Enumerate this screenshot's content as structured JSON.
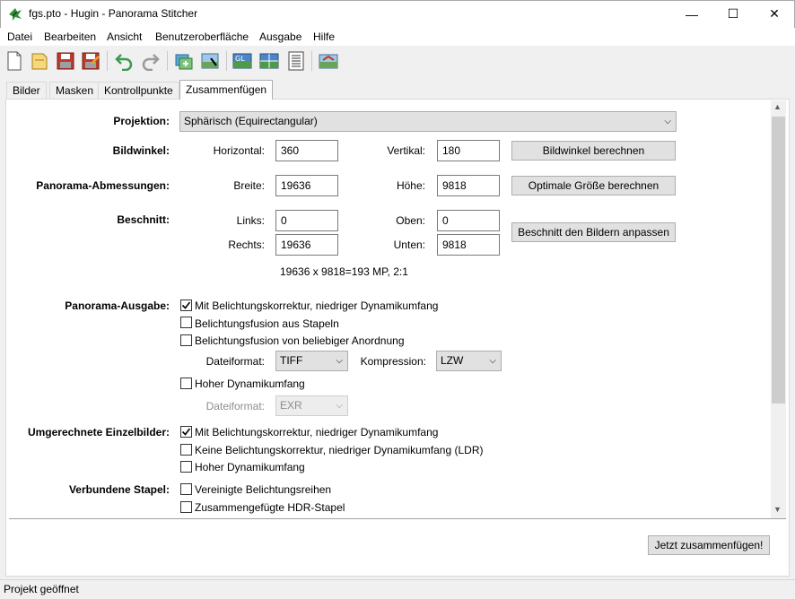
{
  "window": {
    "title": "fgs.pto - Hugin - Panorama Stitcher",
    "minimize": "—",
    "maximize": "☐",
    "close": "✕"
  },
  "menu": [
    {
      "label": "Datei"
    },
    {
      "label": "Bearbeiten"
    },
    {
      "label": "Ansicht"
    },
    {
      "label": "Benutzeroberfläche"
    },
    {
      "label": "Ausgabe"
    },
    {
      "label": "Hilfe"
    }
  ],
  "toolbar": {
    "icons": [
      "new-file-icon",
      "open-file-icon",
      "save-icon",
      "save-as-icon",
      "undo-icon",
      "redo-icon",
      "add-images-icon",
      "control-points-icon",
      "gl-preview-icon",
      "fast-preview-icon",
      "list-icon",
      "layout-preview-icon"
    ],
    "gl_label": "GL"
  },
  "tabs": [
    {
      "label": "Bilder"
    },
    {
      "label": "Masken"
    },
    {
      "label": "Kontrollpunkte"
    },
    {
      "label": "Zusammenfügen",
      "active": true
    }
  ],
  "projection": {
    "label": "Projektion:",
    "value": "Sphärisch (Equirectangular)"
  },
  "field_of_view": {
    "label": "Bildwinkel:",
    "horizontal_label": "Horizontal:",
    "horizontal_value": "360",
    "vertical_label": "Vertikal:",
    "vertical_value": "180",
    "button": "Bildwinkel berechnen"
  },
  "canvas_size": {
    "label": "Panorama-Abmessungen:",
    "width_label": "Breite:",
    "width_value": "19636",
    "height_label": "Höhe:",
    "height_value": "9818",
    "button": "Optimale Größe berechnen"
  },
  "crop": {
    "label": "Beschnitt:",
    "left_label": "Links:",
    "left_value": "0",
    "top_label": "Oben:",
    "top_value": "0",
    "right_label": "Rechts:",
    "right_value": "19636",
    "bottom_label": "Unten:",
    "bottom_value": "9818",
    "button": "Beschnitt den Bildern anpassen",
    "info": "19636 x 9818=193 MP, 2:1"
  },
  "panorama_output": {
    "label": "Panorama-Ausgabe:",
    "options": [
      {
        "label": "Mit Belichtungskorrektur, niedriger Dynamikumfang",
        "checked": true
      },
      {
        "label": "Belichtungsfusion aus Stapeln",
        "checked": false
      },
      {
        "label": "Belichtungsfusion von beliebiger Anordnung",
        "checked": false
      }
    ],
    "format_label": "Dateiformat:",
    "format_value": "TIFF",
    "compression_label": "Kompression:",
    "compression_value": "LZW",
    "hdr_option": {
      "label": "Hoher Dynamikumfang",
      "checked": false
    },
    "hdr_format_label": "Dateiformat:",
    "hdr_format_value": "EXR"
  },
  "remapped_images": {
    "label": "Umgerechnete Einzelbilder:",
    "options": [
      {
        "label": "Mit Belichtungskorrektur, niedriger Dynamikumfang",
        "checked": true
      },
      {
        "label": "Keine Belichtungskorrektur, niedriger Dynamikumfang (LDR)",
        "checked": false
      },
      {
        "label": "Hoher Dynamikumfang",
        "checked": false
      }
    ]
  },
  "combined_stacks": {
    "label": "Verbundene Stapel:",
    "options": [
      {
        "label": "Vereinigte Belichtungsreihen",
        "checked": false
      },
      {
        "label": "Zusammengefügte HDR-Stapel",
        "checked": false
      }
    ]
  },
  "stitch_button": "Jetzt zusammenfügen!",
  "status": "Projekt geöffnet",
  "scroll_up": "▲",
  "scroll_down": "▼"
}
